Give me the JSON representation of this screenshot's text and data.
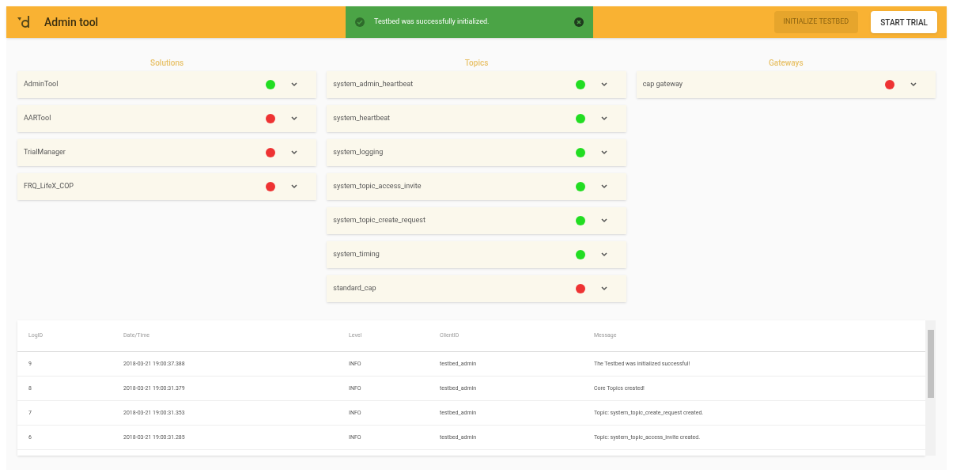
{
  "header": {
    "title": "Admin tool",
    "buttons": [
      {
        "label": "INITIALIZE TESTBED",
        "disabled": true
      },
      {
        "label": "START TRIAL",
        "disabled": false
      }
    ]
  },
  "toast": {
    "message": "Testbed was successfully initialized."
  },
  "columns": [
    {
      "title": "Solutions",
      "items": [
        {
          "name": "AdminTool",
          "color": "#22dd22"
        },
        {
          "name": "AARTool",
          "color": "#ee3333"
        },
        {
          "name": "TrialManager",
          "color": "#ee3333"
        },
        {
          "name": "FRQ_LifeX_COP",
          "color": "#ee3333"
        }
      ]
    },
    {
      "title": "Topics",
      "items": [
        {
          "name": "system_admin_heartbeat",
          "color": "#22dd22"
        },
        {
          "name": "system_heartbeat",
          "color": "#22dd22"
        },
        {
          "name": "system_logging",
          "color": "#22dd22"
        },
        {
          "name": "system_topic_access_invite",
          "color": "#22dd22"
        },
        {
          "name": "system_topic_create_request",
          "color": "#22dd22"
        },
        {
          "name": "system_timing",
          "color": "#22dd22"
        },
        {
          "name": "standard_cap",
          "color": "#ee3333"
        }
      ]
    },
    {
      "title": "Gateways",
      "items": [
        {
          "name": "cap gateway",
          "color": "#ee3333"
        }
      ]
    }
  ],
  "log_table": {
    "columns": [
      "LogID",
      "Date/Time",
      "Level",
      "ClientID",
      "Message"
    ],
    "rows": [
      [
        "9",
        "2018-03-21 19:00:37.388",
        "INFO",
        "testbed_admin",
        "The Testbed was initialized successful!"
      ],
      [
        "8",
        "2018-03-21 19:00:31.379",
        "INFO",
        "testbed_admin",
        "Core Topics created!"
      ],
      [
        "7",
        "2018-03-21 19:00:31.353",
        "INFO",
        "testbed_admin",
        "Topic: system_topic_create_request created."
      ],
      [
        "6",
        "2018-03-21 19:00:31.285",
        "INFO",
        "testbed_admin",
        "Topic: system_topic_access_invite created."
      ]
    ]
  }
}
